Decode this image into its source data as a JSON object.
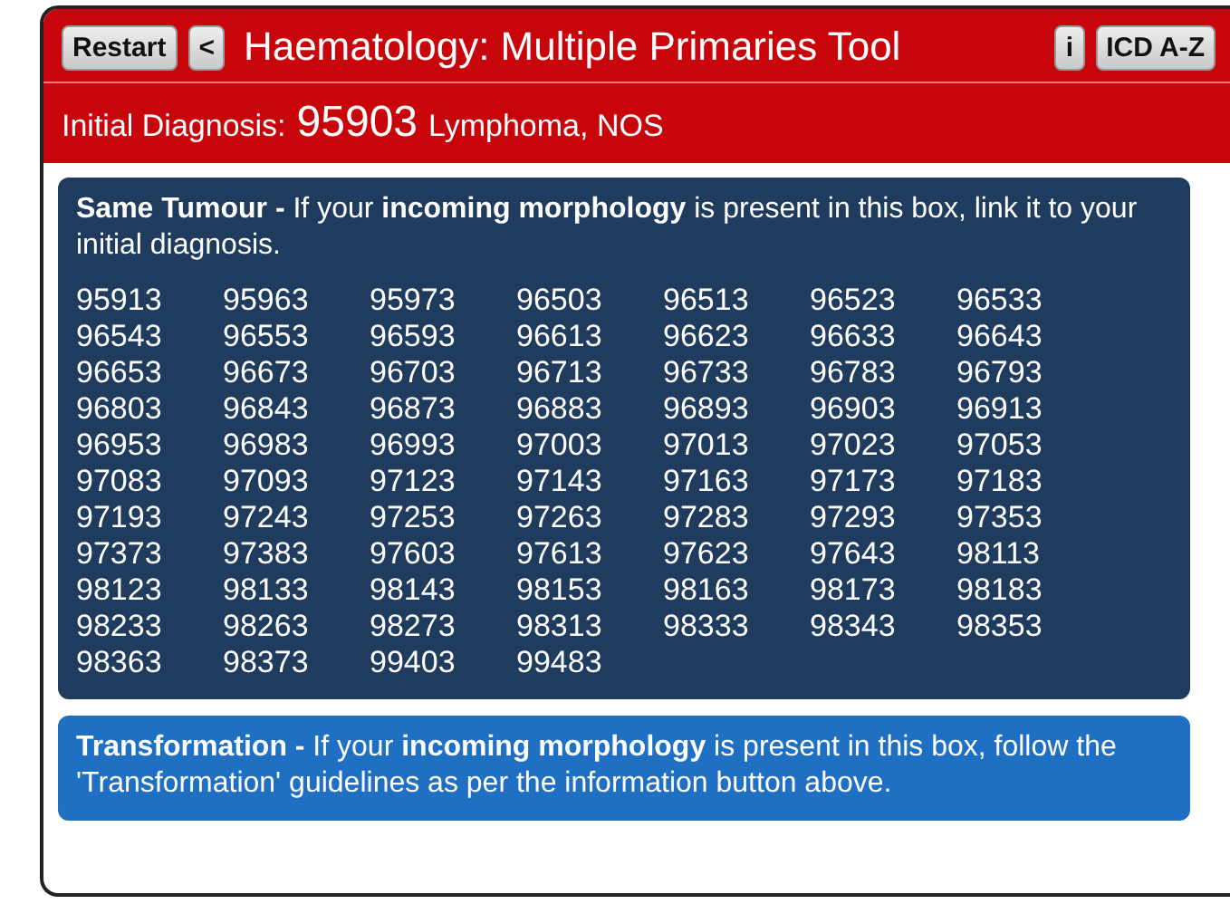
{
  "header": {
    "restart_button": "Restart",
    "back_button": "<",
    "title": "Haematology: Multiple Primaries Tool",
    "info_button": "i",
    "icd_button": "ICD A-Z"
  },
  "diagnosis": {
    "label": "Initial Diagnosis:",
    "code": "95903",
    "name": "Lymphoma, NOS"
  },
  "panels": [
    {
      "kind": "same",
      "text": "**Same Tumour -** If your **incoming morphology** is present in this box, link it to your initial diagnosis.",
      "codes": [
        "95913",
        "95963",
        "95973",
        "96503",
        "96513",
        "96523",
        "96533",
        "96543",
        "96553",
        "96593",
        "96613",
        "96623",
        "96633",
        "96643",
        "96653",
        "96673",
        "96703",
        "96713",
        "96733",
        "96783",
        "96793",
        "96803",
        "96843",
        "96873",
        "96883",
        "96893",
        "96903",
        "96913",
        "96953",
        "96983",
        "96993",
        "97003",
        "97013",
        "97023",
        "97053",
        "97083",
        "97093",
        "97123",
        "97143",
        "97163",
        "97173",
        "97183",
        "97193",
        "97243",
        "97253",
        "97263",
        "97283",
        "97293",
        "97353",
        "97373",
        "97383",
        "97603",
        "97613",
        "97623",
        "97643",
        "98113",
        "98123",
        "98133",
        "98143",
        "98153",
        "98163",
        "98173",
        "98183",
        "98233",
        "98263",
        "98273",
        "98313",
        "98333",
        "98343",
        "98353",
        "98363",
        "98373",
        "99403",
        "99483"
      ]
    },
    {
      "kind": "transformation",
      "text": "**Transformation -** If your **incoming morphology** is present in this box, follow the 'Transformation' guidelines as per the information button above."
    }
  ]
}
